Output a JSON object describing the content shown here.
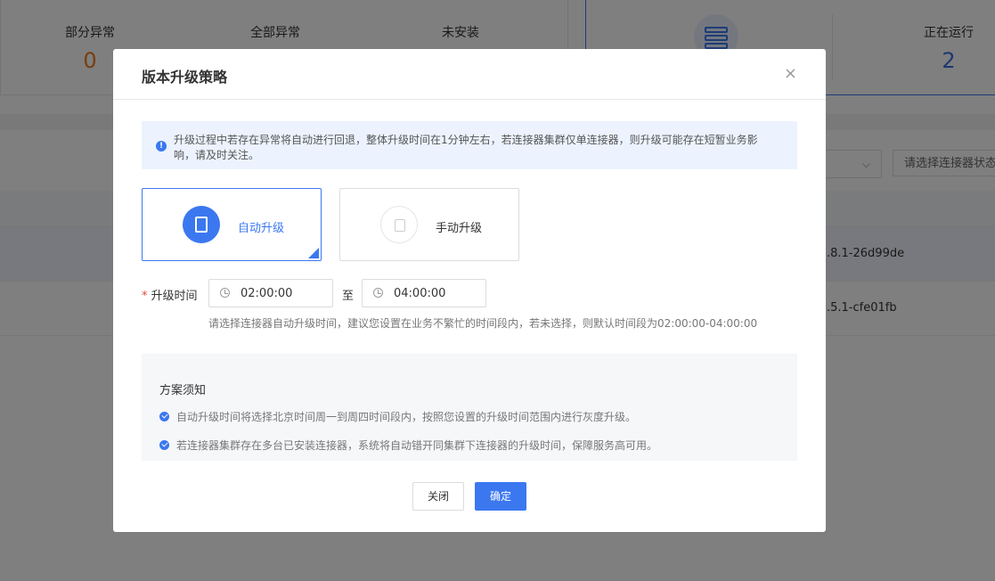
{
  "background": {
    "stats": [
      {
        "label": "部分异常",
        "value": "0"
      },
      {
        "label": "全部异常",
        "value": ""
      },
      {
        "label": "未安装",
        "value": ""
      }
    ],
    "running": {
      "label": "正在运行",
      "value": "2"
    },
    "filter_placeholder": "请选择连接器状态",
    "rows": [
      {
        "version": ".8.1-26d99de"
      },
      {
        "version": ".5.1-cfe01fb"
      }
    ]
  },
  "modal": {
    "title": "版本升级策略",
    "close_icon": "×",
    "info": "升级过程中若存在异常将自动进行回退，整体升级时间在1分钟左右，若连接器集群仅单连接器，则升级可能存在短暂业务影响，请及时关注。",
    "modes": {
      "auto": "自动升级",
      "manual": "手动升级"
    },
    "time": {
      "label": "升级时间",
      "start": "02:00:00",
      "separator": "至",
      "end": "04:00:00",
      "hint": "请选择连接器自动升级时间，建议您设置在业务不繁忙的时间段内，若未选择，则默认时间段为02:00:00-04:00:00"
    },
    "notes": {
      "title": "方案须知",
      "items": [
        "自动升级时间将选择北京时间周一到周四时间段内，按照您设置的升级时间范围内进行灰度升级。",
        "若连接器集群存在多台已安装连接器，系统将自动错开同集群下连接器的升级时间，保障服务高可用。"
      ]
    },
    "buttons": {
      "close": "关闭",
      "confirm": "确定"
    }
  }
}
